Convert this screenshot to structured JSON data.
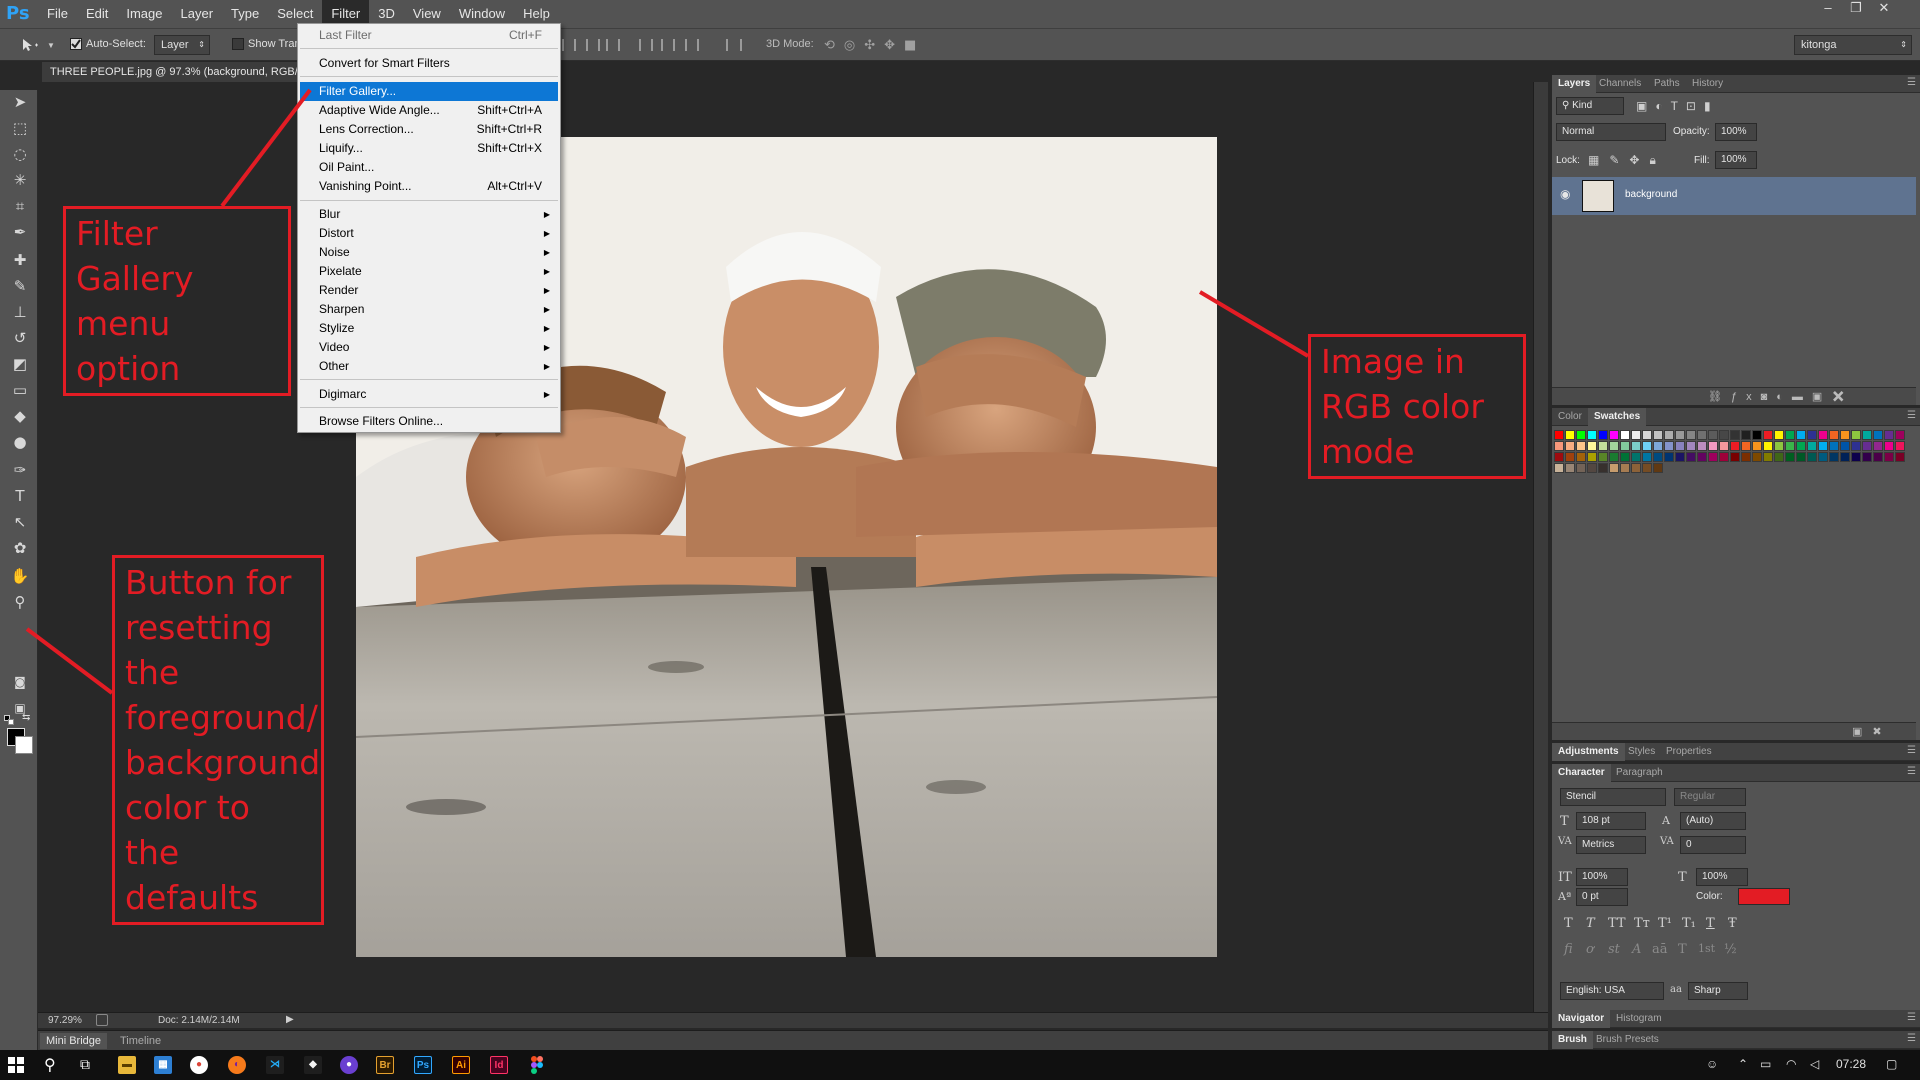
{
  "app": {
    "logo": "Ps",
    "menus": [
      "File",
      "Edit",
      "Image",
      "Layer",
      "Type",
      "Select",
      "Filter",
      "3D",
      "View",
      "Window",
      "Help"
    ],
    "active_menu": "Filter",
    "window_controls": [
      "–",
      "❐",
      "✕"
    ]
  },
  "options_bar": {
    "auto_select_label": "Auto-Select:",
    "auto_select_target": "Layer",
    "show_transform_label": "Show Tran",
    "mode_3d_label": "3D Mode:",
    "workspace": "kitonga"
  },
  "document": {
    "tab_title": "THREE PEOPLE.jpg @ 97.3% (background, RGB/",
    "zoom": "97.29%",
    "doc_size": "Doc: 2.14M/2.14M"
  },
  "bottom_tabs": [
    "Mini Bridge",
    "Timeline"
  ],
  "filter_menu": {
    "items": [
      {
        "label": "Last Filter",
        "shortcut": "Ctrl+F",
        "disabled": true
      },
      {
        "label": "Convert for Smart Filters",
        "shortcut": ""
      },
      {
        "label": "Filter Gallery...",
        "shortcut": "",
        "highlighted": true
      },
      {
        "label": "Adaptive Wide Angle...",
        "shortcut": "Shift+Ctrl+A"
      },
      {
        "label": "Lens Correction...",
        "shortcut": "Shift+Ctrl+R"
      },
      {
        "label": "Liquify...",
        "shortcut": "Shift+Ctrl+X"
      },
      {
        "label": "Oil Paint...",
        "shortcut": ""
      },
      {
        "label": "Vanishing Point...",
        "shortcut": "Alt+Ctrl+V"
      },
      {
        "label": "Blur",
        "submenu": true
      },
      {
        "label": "Distort",
        "submenu": true
      },
      {
        "label": "Noise",
        "submenu": true
      },
      {
        "label": "Pixelate",
        "submenu": true
      },
      {
        "label": "Render",
        "submenu": true
      },
      {
        "label": "Sharpen",
        "submenu": true
      },
      {
        "label": "Stylize",
        "submenu": true
      },
      {
        "label": "Video",
        "submenu": true
      },
      {
        "label": "Other",
        "submenu": true
      },
      {
        "label": "Digimarc",
        "submenu": true
      },
      {
        "label": "Browse Filters Online...",
        "shortcut": ""
      }
    ]
  },
  "layers_panel": {
    "tabs": [
      "Layers",
      "Channels",
      "Paths",
      "History"
    ],
    "kind": "Kind",
    "blend_mode": "Normal",
    "opacity_label": "Opacity:",
    "opacity": "100%",
    "lock_label": "Lock:",
    "fill_label": "Fill:",
    "fill": "100%",
    "layers": [
      {
        "name": "background",
        "visible": true
      }
    ]
  },
  "swatches_panel": {
    "tabs": [
      "Color",
      "Swatches"
    ]
  },
  "adjustments_panel": {
    "tabs": [
      "Adjustments",
      "Styles",
      "Properties"
    ]
  },
  "character_panel": {
    "tabs": [
      "Character",
      "Paragraph"
    ],
    "font_family": "Stencil",
    "font_style": "Regular",
    "size": "108 pt",
    "leading": "(Auto)",
    "kerning": "Metrics",
    "tracking": "0",
    "vertical_scale": "100%",
    "horizontal_scale": "100%",
    "baseline_shift": "0 pt",
    "color_label": "Color:",
    "color": "#e31c24",
    "style_glyphs": [
      "T",
      "T",
      "TT",
      "Tт",
      "T¹",
      "T₁",
      "T",
      "Ŧ"
    ],
    "opentype_glyphs": [
      "fi",
      "ơ",
      "st",
      "A",
      "aā",
      "T",
      "1st",
      "½"
    ],
    "language": "English: USA",
    "aa_label": "aa",
    "antialias": "Sharp"
  },
  "navigator_panel": {
    "tabs": [
      "Navigator",
      "Histogram"
    ]
  },
  "brush_panel": {
    "tabs": [
      "Brush",
      "Brush Presets"
    ]
  },
  "annotations": {
    "filter_gallery": "Filter Gallery menu option",
    "rgb_mode": "Image in RGB color mode",
    "reset_button": "Button for resetting the foreground/ background color to the defaults",
    "color": "#e31c24"
  },
  "taskbar": {
    "apps": [
      "Br",
      "Ps",
      "Ai",
      "Id"
    ],
    "time": "07:28"
  }
}
